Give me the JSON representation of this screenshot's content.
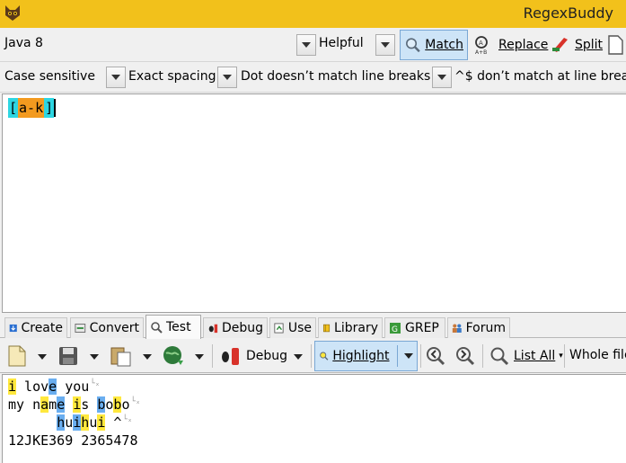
{
  "window": {
    "title": "RegexBuddy",
    "app_icon": "regexbuddy-cat-icon"
  },
  "toolbar1": {
    "flavor": "Java 8",
    "helpful": "Helpful",
    "match": "Match",
    "replace": "Replace",
    "split": "Split"
  },
  "toolbar2_options": {
    "case": "Case sensitive",
    "spacing": "Exact spacing",
    "dot": "Dot doesn’t match line breaks",
    "anchors": "^$ don’t match at line breaks"
  },
  "regex": {
    "open": "[",
    "mid": "a-k",
    "close": "]"
  },
  "tabs": [
    {
      "label": "Create",
      "icon": "create-icon"
    },
    {
      "label": "Convert",
      "icon": "convert-icon"
    },
    {
      "label": "Test",
      "icon": "test-magnifier-icon"
    },
    {
      "label": "Debug",
      "icon": "debug-icon"
    },
    {
      "label": "Use",
      "icon": "use-icon"
    },
    {
      "label": "Library",
      "icon": "library-icon"
    },
    {
      "label": "GREP",
      "icon": "grep-icon"
    },
    {
      "label": "Forum",
      "icon": "forum-icon"
    }
  ],
  "test_toolbar": {
    "debug": "Debug",
    "highlight": "Highlight",
    "list_all": "List All",
    "scope": "Whole file"
  },
  "test_text": {
    "line1": [
      {
        "t": "i",
        "h": "y"
      },
      {
        "t": " lov",
        "h": ""
      },
      {
        "t": "e",
        "h": "b"
      },
      {
        "t": " you",
        "h": ""
      }
    ],
    "line2": [
      {
        "t": "my n",
        "h": ""
      },
      {
        "t": "a",
        "h": "y"
      },
      {
        "t": "m",
        "h": ""
      },
      {
        "t": "e",
        "h": "b"
      },
      {
        "t": " ",
        "h": ""
      },
      {
        "t": "i",
        "h": "y"
      },
      {
        "t": "s ",
        "h": ""
      },
      {
        "t": "b",
        "h": "b"
      },
      {
        "t": "o",
        "h": ""
      },
      {
        "t": "b",
        "h": "y"
      },
      {
        "t": "o",
        "h": ""
      }
    ],
    "line3": [
      {
        "t": "      ",
        "h": ""
      },
      {
        "t": "h",
        "h": "b"
      },
      {
        "t": "u",
        "h": ""
      },
      {
        "t": "i",
        "h": "b"
      },
      {
        "t": "h",
        "h": "y"
      },
      {
        "t": "u",
        "h": ""
      },
      {
        "t": "i",
        "h": "y"
      },
      {
        "t": " ^",
        "h": ""
      }
    ],
    "line4": [
      {
        "t": "12JKE369 2365478",
        "h": ""
      }
    ]
  },
  "colors": {
    "titlebar": "#f2c11b",
    "highlight_yellow": "#ffe83d",
    "highlight_blue": "#6aaef0",
    "regex_bracket": "#2dd6e2",
    "regex_range": "#f39a1f"
  }
}
